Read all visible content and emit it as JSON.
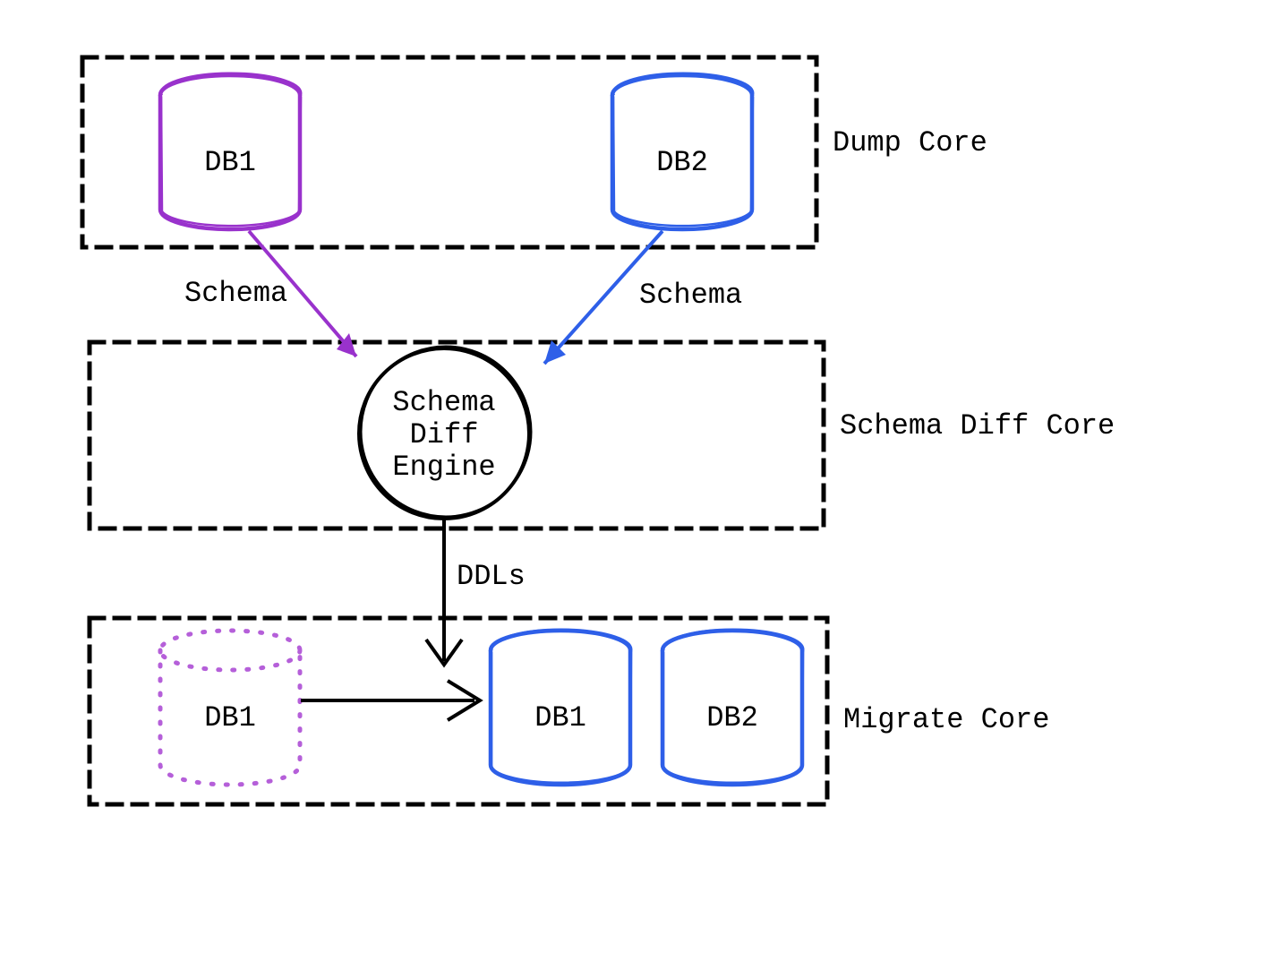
{
  "boxes": {
    "dump": {
      "label": "Dump Core"
    },
    "diff": {
      "label": "Schema Diff Core"
    },
    "migrate": {
      "label": "Migrate Core"
    }
  },
  "nodes": {
    "db1_source": {
      "label": "DB1"
    },
    "db2_source": {
      "label": "DB2"
    },
    "engine_line1": "Schema",
    "engine_line2": "Diff",
    "engine_line3": "Engine",
    "db1_ghost": {
      "label": "DB1"
    },
    "db1_migrated": {
      "label": "DB1"
    },
    "db2_migrated": {
      "label": "DB2"
    }
  },
  "edges": {
    "db1_schema": {
      "label": "Schema"
    },
    "db2_schema": {
      "label": "Schema"
    },
    "ddls": {
      "label": "DDLs"
    }
  },
  "colors": {
    "purple": "#9932cc",
    "blue": "#2e5fe8",
    "black": "#000000"
  }
}
